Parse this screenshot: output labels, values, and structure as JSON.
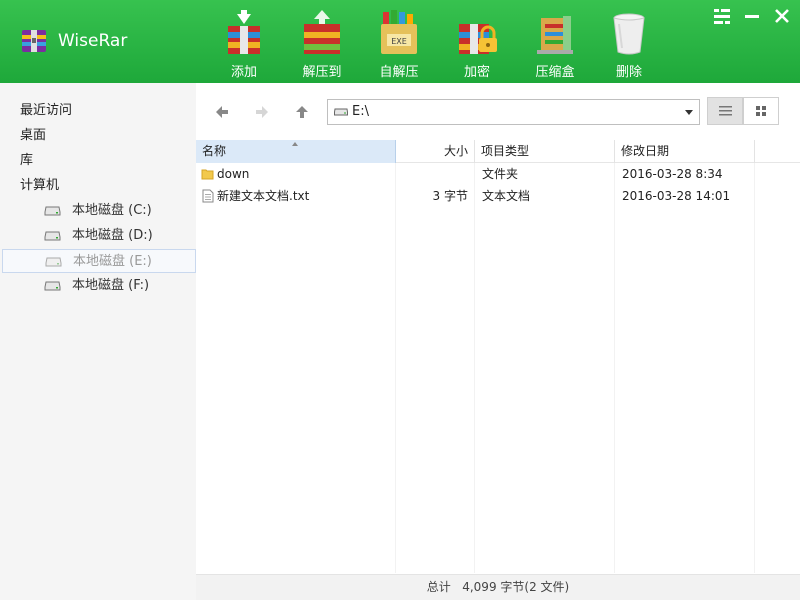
{
  "app": {
    "title": "WiseRar"
  },
  "toolbar": [
    {
      "label": "添加",
      "icon": "add-archive-icon"
    },
    {
      "label": "解压到",
      "icon": "extract-to-icon"
    },
    {
      "label": "自解压",
      "icon": "self-extract-exe-icon"
    },
    {
      "label": "加密",
      "icon": "encrypt-lock-icon"
    },
    {
      "label": "压缩盒",
      "icon": "archive-box-icon"
    },
    {
      "label": "删除",
      "icon": "trash-icon"
    }
  ],
  "sidebar": {
    "items": [
      {
        "label": "最近访问"
      },
      {
        "label": "桌面"
      },
      {
        "label": "库"
      },
      {
        "label": "计算机"
      }
    ],
    "drives": [
      {
        "label": "本地磁盘 (C:)"
      },
      {
        "label": "本地磁盘 (D:)"
      },
      {
        "label": "本地磁盘 (E:)",
        "selected": true
      },
      {
        "label": "本地磁盘 (F:)"
      }
    ]
  },
  "address": {
    "path": "E:\\"
  },
  "columns": {
    "name": "名称",
    "size": "大小",
    "type": "项目类型",
    "date": "修改日期"
  },
  "files": [
    {
      "name": "down",
      "size": "",
      "type": "文件夹",
      "date": "2016-03-28 8:34",
      "icon": "folder-icon"
    },
    {
      "name": "新建文本文档.txt",
      "size": "3 字节",
      "type": "文本文档",
      "date": "2016-03-28 14:01",
      "icon": "text-file-icon"
    }
  ],
  "status": {
    "text": "总计   4,099 字节(2 文件)"
  },
  "colors": {
    "accent": "#1ea83a",
    "selection": "#dbe9f8"
  }
}
